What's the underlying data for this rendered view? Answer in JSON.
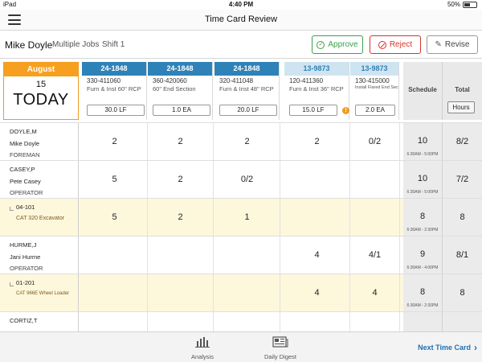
{
  "status_bar": {
    "device": "iPad",
    "time": "4:40 PM",
    "battery": "50%"
  },
  "nav": {
    "title": "Time Card Review",
    "menu_icon": "hamburger-menu-icon"
  },
  "header": {
    "employee": "Mike Doyle",
    "jobs": "Multiple Jobs",
    "shift": "Shift 1",
    "approve_label": "Approve",
    "reject_label": "Reject",
    "revise_label": "Revise",
    "colors": {
      "approve": "#3aa14b",
      "reject": "#d9342b"
    }
  },
  "date": {
    "month": "August",
    "day": "15",
    "label": "TODAY",
    "accent": "#f7a01f"
  },
  "jobs": [
    {
      "job": "24-1848",
      "code": "330-411060",
      "desc": "Furn & Inst 60\" RCP",
      "qty": "30.0 LF",
      "style": "dark",
      "warn": false
    },
    {
      "job": "24-1848",
      "code": "360-420060",
      "desc": "60\" End Section",
      "qty": "1.0 EA",
      "style": "dark",
      "warn": false
    },
    {
      "job": "24-1848",
      "code": "320-411048",
      "desc": "Furn & Inst 48\" RCP",
      "qty": "20.0 LF",
      "style": "dark",
      "warn": false
    },
    {
      "job": "13-9873",
      "code": "120-411360",
      "desc": "Furn & Inst 36\" RCP",
      "qty": "15.0 LF",
      "style": "light",
      "warn": true
    },
    {
      "job": "13-9873",
      "code": "130-415000",
      "desc": "Install Flared End Section",
      "qty": "2.0 EA",
      "style": "light",
      "warn": false
    }
  ],
  "columns": {
    "schedule": "Schedule",
    "total": "Total",
    "hours_button": "Hours",
    "warn_symbol": "!"
  },
  "rows": [
    {
      "type": "person",
      "l1": "DOYLE,M",
      "l2": "Mike Doyle",
      "l3": "FOREMAN",
      "values": [
        "2",
        "2",
        "2",
        "2",
        "0/2"
      ],
      "schedule": "10",
      "range": "6:30AM - 5:00PM",
      "total": "8/2"
    },
    {
      "type": "person",
      "l1": "CASEY,P",
      "l2": "Pete Casey",
      "l3": "OPERATOR",
      "values": [
        "5",
        "2",
        "0/2",
        "",
        ""
      ],
      "schedule": "10",
      "range": "6:30AM - 5:00PM",
      "total": "7/2"
    },
    {
      "type": "equip",
      "l1": "04-101",
      "l2": "CAT 320 Excavator",
      "l3": "",
      "values": [
        "5",
        "2",
        "1",
        "",
        ""
      ],
      "schedule": "8",
      "range": "6:30AM - 2:30PM",
      "total": "8"
    },
    {
      "type": "person",
      "l1": "HURME,J",
      "l2": "Jani Hurme",
      "l3": "OPERATOR",
      "values": [
        "",
        "",
        "",
        "4",
        "4/1"
      ],
      "schedule": "9",
      "range": "6:30AM - 4:00PM",
      "total": "8/1"
    },
    {
      "type": "equip",
      "l1": "01-201",
      "l2": "CAT 966E Wheel Loader",
      "l3": "",
      "values": [
        "",
        "",
        "",
        "4",
        "4"
      ],
      "schedule": "8",
      "range": "6:30AM - 2:30PM",
      "total": "8"
    },
    {
      "type": "person",
      "l1": "CORTIZ,T",
      "l2": "",
      "l3": "",
      "values": [
        "",
        "",
        "",
        "",
        ""
      ],
      "schedule": "",
      "range": "",
      "total": ""
    }
  ],
  "bottom": {
    "analysis": "Analysis",
    "digest": "Daily Digest",
    "next": "Next Time Card"
  }
}
